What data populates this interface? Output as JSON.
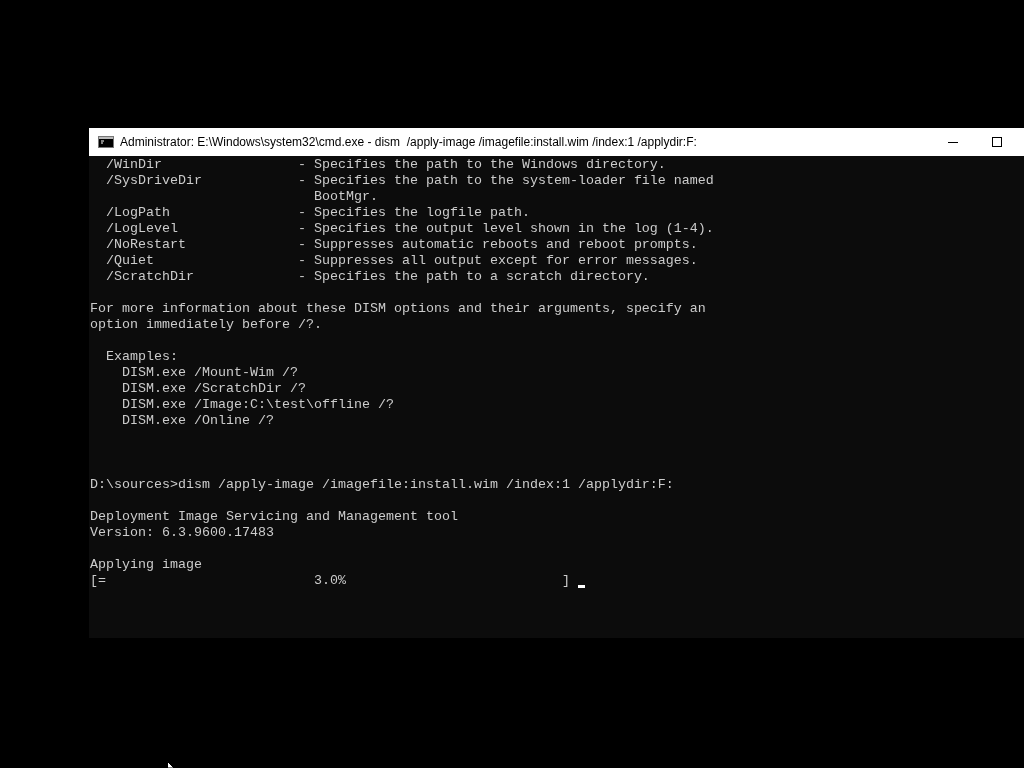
{
  "window": {
    "title": "Administrator: E:\\Windows\\system32\\cmd.exe - dism  /apply-image /imagefile:install.wim /index:1 /applydir:F:"
  },
  "console": {
    "lines": [
      {
        "kind": "text",
        "text": "  /WinDir                 - Specifies the path to the Windows directory."
      },
      {
        "kind": "text",
        "text": "  /SysDriveDir            - Specifies the path to the system-loader file named"
      },
      {
        "kind": "text",
        "text": "                            BootMgr."
      },
      {
        "kind": "text",
        "text": "  /LogPath                - Specifies the logfile path."
      },
      {
        "kind": "text",
        "text": "  /LogLevel               - Specifies the output level shown in the log (1-4)."
      },
      {
        "kind": "text",
        "text": "  /NoRestart              - Suppresses automatic reboots and reboot prompts."
      },
      {
        "kind": "text",
        "text": "  /Quiet                  - Suppresses all output except for error messages."
      },
      {
        "kind": "text",
        "text": "  /ScratchDir             - Specifies the path to a scratch directory."
      },
      {
        "kind": "blank"
      },
      {
        "kind": "text",
        "text": "For more information about these DISM options and their arguments, specify an"
      },
      {
        "kind": "text",
        "text": "option immediately before /?."
      },
      {
        "kind": "blank"
      },
      {
        "kind": "text",
        "text": "  Examples:"
      },
      {
        "kind": "text",
        "text": "    DISM.exe /Mount-Wim /?"
      },
      {
        "kind": "text",
        "text": "    DISM.exe /ScratchDir /?"
      },
      {
        "kind": "text",
        "text": "    DISM.exe /Image:C:\\test\\offline /?"
      },
      {
        "kind": "text",
        "text": "    DISM.exe /Online /?"
      },
      {
        "kind": "blank"
      },
      {
        "kind": "blank"
      },
      {
        "kind": "blank"
      },
      {
        "kind": "text",
        "text": "D:\\sources>dism /apply-image /imagefile:install.wim /index:1 /applydir:F:"
      },
      {
        "kind": "blank"
      },
      {
        "kind": "text",
        "text": "Deployment Image Servicing and Management tool"
      },
      {
        "kind": "text",
        "text": "Version: 6.3.9600.17483"
      },
      {
        "kind": "blank"
      },
      {
        "kind": "text",
        "text": "Applying image"
      },
      {
        "kind": "progress",
        "open": "[",
        "fill": "=",
        "reading": "3.0%",
        "close": "]",
        "level": 0.03,
        "cursor": true
      }
    ]
  }
}
